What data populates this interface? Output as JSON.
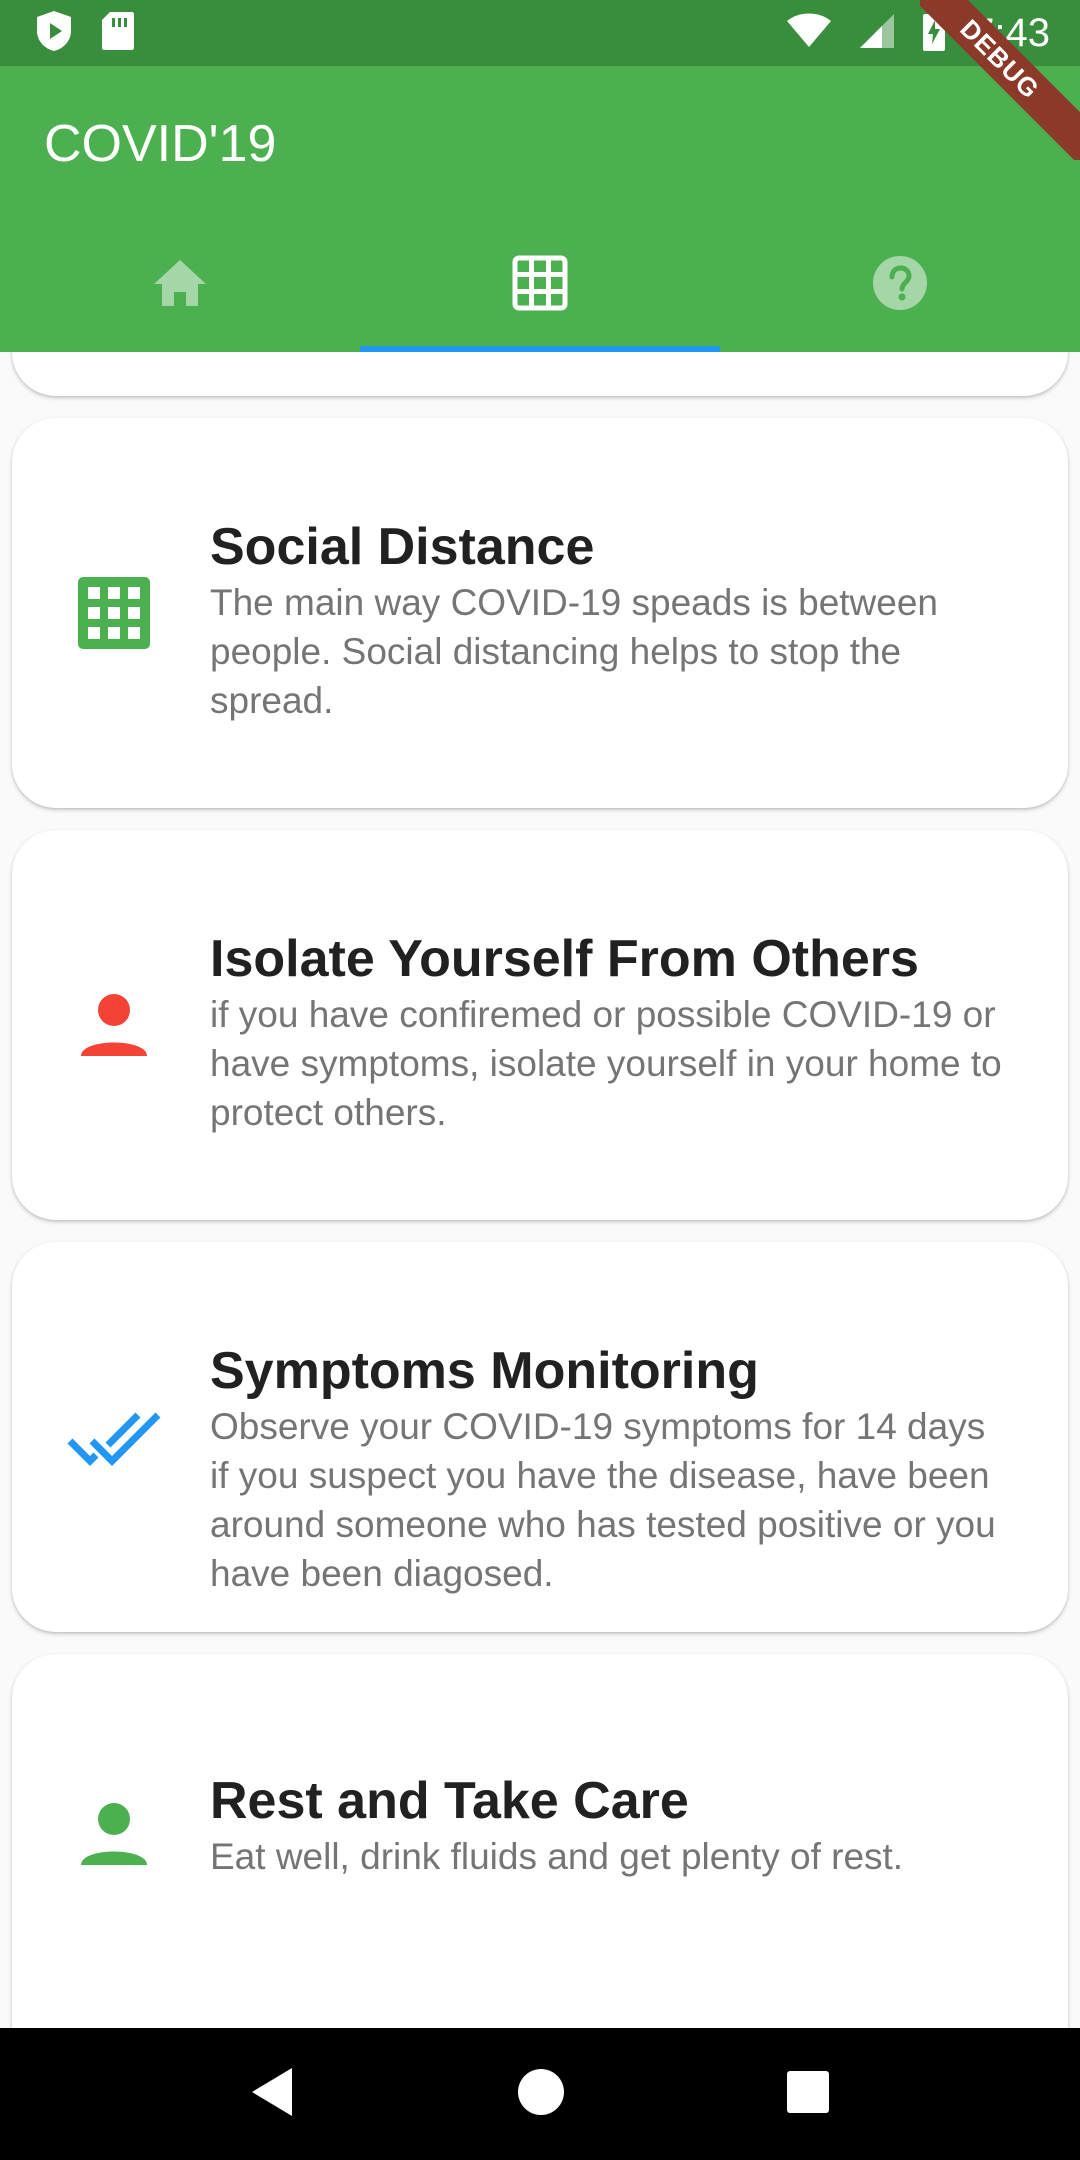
{
  "status_bar": {
    "time": "7:43",
    "icons": [
      "shield-play-icon",
      "sd-card-icon",
      "wifi-icon",
      "cell-signal-icon",
      "battery-charging-icon"
    ]
  },
  "debug_banner": {
    "label": "DEBUG"
  },
  "app_bar": {
    "title": "COVID'19",
    "tabs": [
      {
        "icon": "home-icon",
        "active": false
      },
      {
        "icon": "grid-icon",
        "active": true
      },
      {
        "icon": "help-icon",
        "active": false
      }
    ]
  },
  "cards": [
    {
      "icon": "grid-icon",
      "icon_color": "#4caf50",
      "title": "Social Distance",
      "description": "The main way COVID-19 speads is between people. Social distancing helps to stop the spread."
    },
    {
      "icon": "person-icon",
      "icon_color": "#f44336",
      "title": "Isolate Yourself From Others",
      "description": "if you have confiremed or possible COVID-19 or have symptoms, isolate yourself in your home to protect others."
    },
    {
      "icon": "double-check-icon",
      "icon_color": "#2196f3",
      "title": "Symptoms Monitoring",
      "description": "Observe your COVID-19 symptoms for 14 days if you suspect you have the disease, have been around someone who has tested positive or you have been diagosed."
    },
    {
      "icon": "person-icon",
      "icon_color": "#4caf50",
      "title": "Rest and Take Care",
      "description": "Eat well, drink fluids and get plenty of rest."
    }
  ],
  "nav_bar": {
    "buttons": [
      "back-icon",
      "home-circle-icon",
      "recents-icon"
    ]
  },
  "colors": {
    "primary": "#4caf50",
    "primary_dark": "#388e3c",
    "tab_indicator": "#2196f3"
  }
}
